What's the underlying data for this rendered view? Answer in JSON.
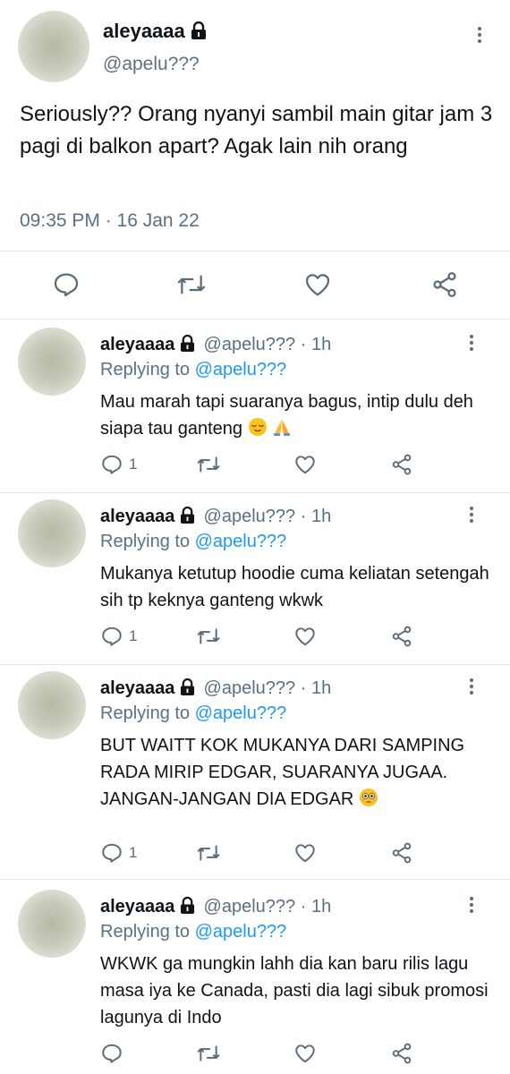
{
  "main": {
    "name": "aleyaaaa",
    "handle": "@apelu???",
    "text": "Seriously?? Orang nyanyi sambil main gitar jam 3 pagi di balkon apart? Agak lain nih orang",
    "time": "09:35 PM · 16 Jan 22"
  },
  "replies": [
    {
      "name": "aleyaaaa",
      "handle": "@apelu???",
      "sep": "·",
      "time": "1h",
      "replying_prefix": "Replying to ",
      "replying_to": "@apelu???",
      "text": "Mau marah tapi suaranya bagus, intip dulu deh siapa tau ganteng",
      "emojis": [
        "relieved-face",
        "folded-hands"
      ],
      "reply_count": "1"
    },
    {
      "name": "aleyaaaa",
      "handle": "@apelu???",
      "sep": "·",
      "time": "1h",
      "replying_prefix": "Replying to ",
      "replying_to": "@apelu???",
      "text": "Mukanya ketutup hoodie cuma keliatan setengah sih tp keknya ganteng wkwk",
      "reply_count": "1"
    },
    {
      "name": "aleyaaaa",
      "handle": "@apelu???",
      "sep": "·",
      "time": "1h",
      "replying_prefix": "Replying to ",
      "replying_to": "@apelu???",
      "text": "BUT WAITT KOK MUKANYA DARI SAMPING RADA MIRIP EDGAR, SUARANYA JUGAA. JANGAN-JANGAN DIA EDGAR",
      "emojis": [
        "flushed-face"
      ],
      "reply_count": "1"
    },
    {
      "name": "aleyaaaa",
      "handle": "@apelu???",
      "sep": "·",
      "time": "1h",
      "replying_prefix": "Replying to ",
      "replying_to": "@apelu???",
      "text": "WKWK ga mungkin lahh dia kan baru rilis lagu masa iya ke Canada, pasti dia lagi sibuk promosi lagunya di Indo",
      "reply_count": ""
    }
  ],
  "colors": {
    "text": "#0f1419",
    "secondary": "#5b7083",
    "link": "#1d9bf0",
    "divider": "#e1e6ea"
  },
  "icons": [
    "lock-icon",
    "more-icon",
    "reply-icon",
    "retweet-icon",
    "like-icon",
    "share-icon"
  ]
}
